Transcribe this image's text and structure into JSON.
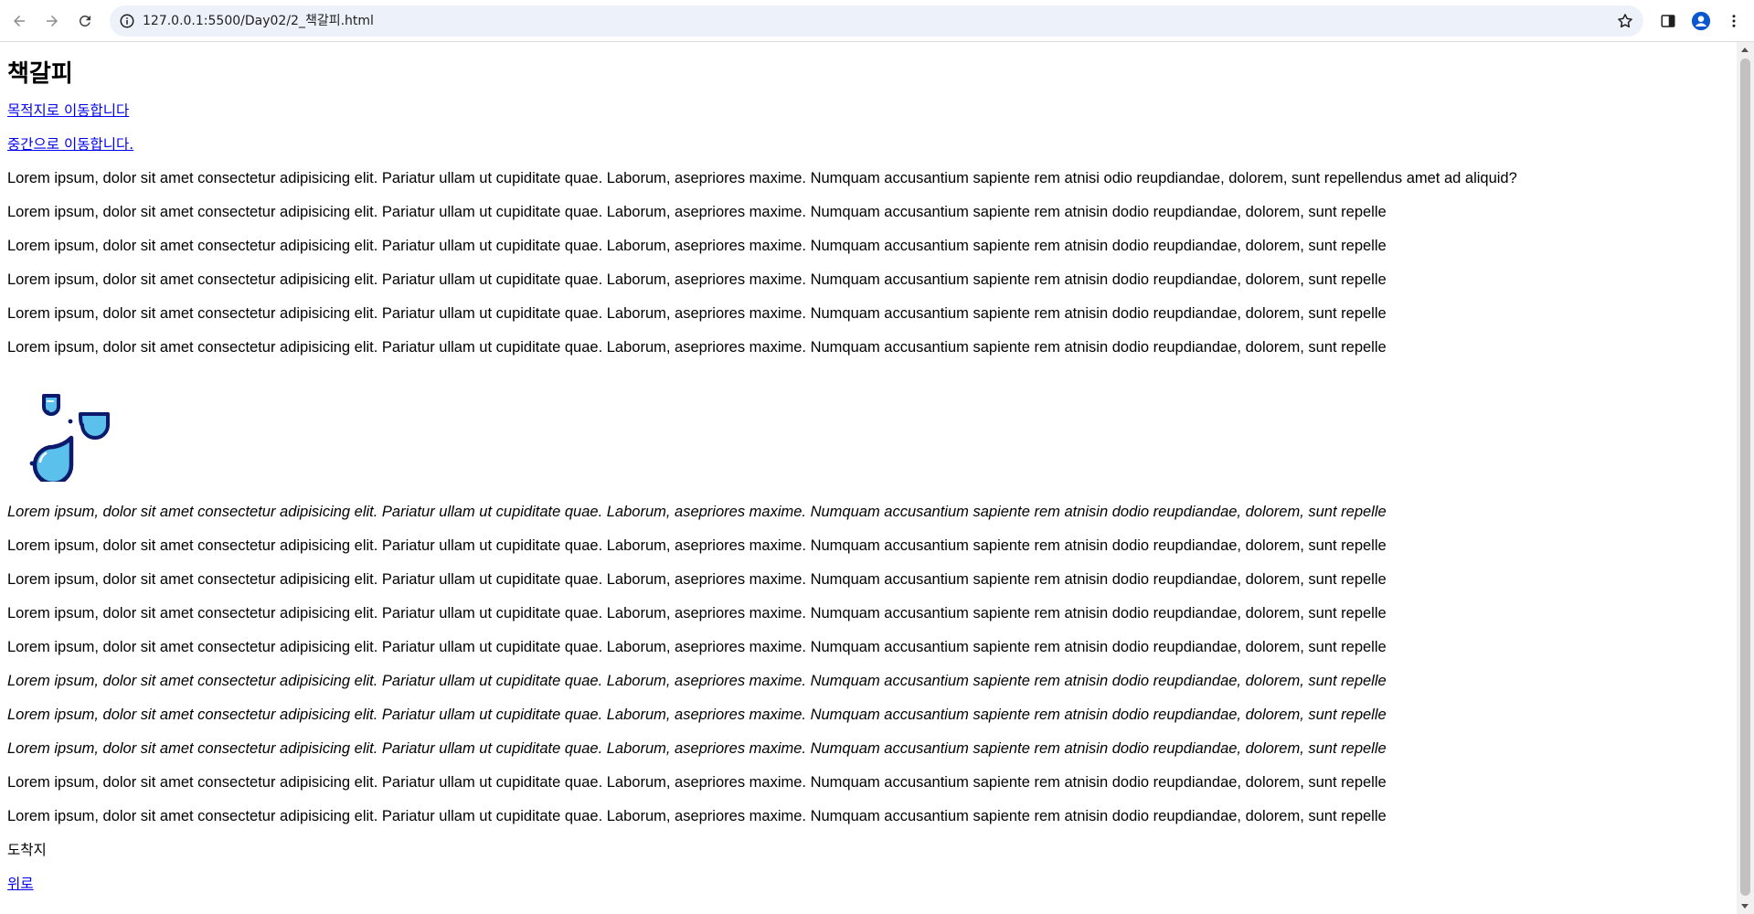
{
  "browser": {
    "url": "127.0.0.1:5500/Day02/2_책갈피.html",
    "icons": {
      "back": "arrow-left-icon",
      "forward": "arrow-right-icon",
      "reload": "reload-icon",
      "site_info": "info-circle-icon",
      "bookmark": "star-icon",
      "side_panel": "side-panel-icon",
      "profile": "person-icon",
      "menu": "kebab-menu-icon"
    },
    "colors": {
      "omnibox_bg": "#edf2fa",
      "profile": "#0b57d0"
    }
  },
  "page": {
    "title": "책갈피",
    "links": {
      "to_destination": "목적지로 이동합니다",
      "to_middle": "중간으로 이동합니다."
    },
    "paragraphs_top": [
      "Lorem ipsum, dolor sit amet consectetur adipisicing elit. Pariatur ullam ut cupiditate quae. Laborum, asepriores maxime. Numquam accusantium sapiente rem atnisi odio reupdiandae, dolorem, sunt repellendus amet ad aliquid?",
      "Lorem ipsum, dolor sit amet consectetur adipisicing elit. Pariatur ullam ut cupiditate quae. Laborum, asepriores maxime. Numquam accusantium sapiente rem atnisin dodio reupdiandae, dolorem, sunt repelle",
      "Lorem ipsum, dolor sit amet consectetur adipisicing elit. Pariatur ullam ut cupiditate quae. Laborum, asepriores maxime. Numquam accusantium sapiente rem atnisin dodio reupdiandae, dolorem, sunt repelle",
      "Lorem ipsum, dolor sit amet consectetur adipisicing elit. Pariatur ullam ut cupiditate quae. Laborum, asepriores maxime. Numquam accusantium sapiente rem atnisin dodio reupdiandae, dolorem, sunt repelle",
      "Lorem ipsum, dolor sit amet consectetur adipisicing elit. Pariatur ullam ut cupiditate quae. Laborum, asepriores maxime. Numquam accusantium sapiente rem atnisin dodio reupdiandae, dolorem, sunt repelle",
      "Lorem ipsum, dolor sit amet consectetur adipisicing elit. Pariatur ullam ut cupiditate quae. Laborum, asepriores maxime. Numquam accusantium sapiente rem atnisin dodio reupdiandae, dolorem, sunt repelle"
    ],
    "image_icon": "water-drops-icon",
    "image_colors": {
      "fill": "#5bc0eb",
      "stroke": "#0b1a6b"
    },
    "paragraphs_bottom": [
      "Lorem ipsum, dolor sit amet consectetur adipisicing elit. Pariatur ullam ut cupiditate quae. Laborum, asepriores maxime. Numquam accusantium sapiente rem atnisin dodio reupdiandae, dolorem, sunt repelle",
      "Lorem ipsum, dolor sit amet consectetur adipisicing elit. Pariatur ullam ut cupiditate quae. Laborum, asepriores maxime. Numquam accusantium sapiente rem atnisin dodio reupdiandae, dolorem, sunt repelle",
      "Lorem ipsum, dolor sit amet consectetur adipisicing elit. Pariatur ullam ut cupiditate quae. Laborum, asepriores maxime. Numquam accusantium sapiente rem atnisin dodio reupdiandae, dolorem, sunt repelle",
      "Lorem ipsum, dolor sit amet consectetur adipisicing elit. Pariatur ullam ut cupiditate quae. Laborum, asepriores maxime. Numquam accusantium sapiente rem atnisin dodio reupdiandae, dolorem, sunt repelle",
      "Lorem ipsum, dolor sit amet consectetur adipisicing elit. Pariatur ullam ut cupiditate quae. Laborum, asepriores maxime. Numquam accusantium sapiente rem atnisin dodio reupdiandae, dolorem, sunt repelle",
      "Lorem ipsum, dolor sit amet consectetur adipisicing elit. Pariatur ullam ut cupiditate quae. Laborum, asepriores maxime. Numquam accusantium sapiente rem atnisin dodio reupdiandae, dolorem, sunt repelle",
      "Lorem ipsum, dolor sit amet consectetur adipisicing elit. Pariatur ullam ut cupiditate quae. Laborum, asepriores maxime. Numquam accusantium sapiente rem atnisin dodio reupdiandae, dolorem, sunt repelle",
      "Lorem ipsum, dolor sit amet consectetur adipisicing elit. Pariatur ullam ut cupiditate quae. Laborum, asepriores maxime. Numquam accusantium sapiente rem atnisin dodio reupdiandae, dolorem, sunt repelle",
      "Lorem ipsum, dolor sit amet consectetur adipisicing elit. Pariatur ullam ut cupiditate quae. Laborum, asepriores maxime. Numquam accusantium sapiente rem atnisin dodio reupdiandae, dolorem, sunt repelle",
      "Lorem ipsum, dolor sit amet consectetur adipisicing elit. Pariatur ullam ut cupiditate quae. Laborum, asepriores maxime. Numquam accusantium sapiente rem atnisin dodio reupdiandae, dolorem, sunt repelle"
    ],
    "destination": "도착지",
    "back_to_top": "위로"
  }
}
